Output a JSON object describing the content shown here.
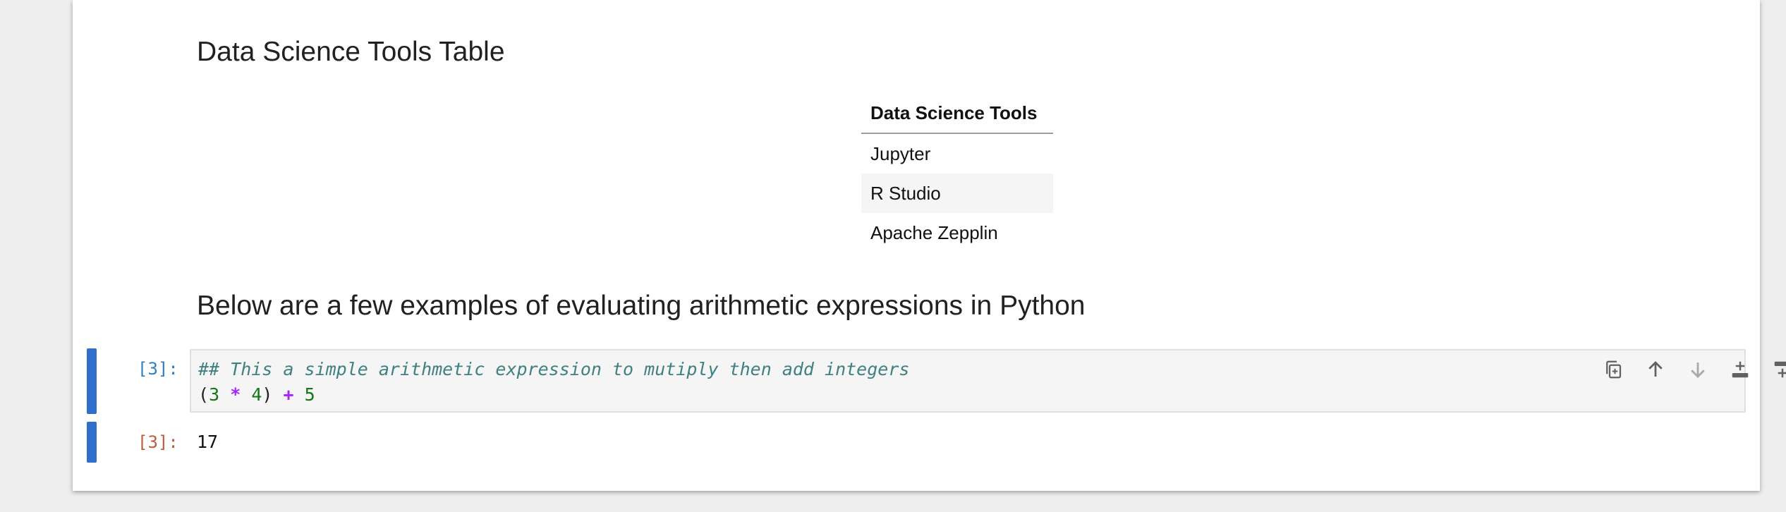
{
  "markdown": {
    "heading_1": "Data Science Tools Table",
    "heading_2": "Below are a few examples of evaluating arithmetic expressions in Python"
  },
  "tools_table": {
    "header": "Data Science Tools",
    "rows": [
      "Jupyter",
      "R Studio",
      "Apache Zepplin"
    ]
  },
  "code_cell": {
    "in_prompt": "[3]:",
    "comment": "##  This a simple arithmetic expression to mutiply then add integers",
    "tokens": {
      "open_paren": "(",
      "n1": "3",
      "op1": "*",
      "n2": "4",
      "close_paren": ")",
      "op2": "+",
      "n3": "5"
    }
  },
  "output_cell": {
    "out_prompt": "[3]:",
    "value": "17"
  },
  "toolbar": {
    "icons": [
      "duplicate-icon",
      "move-up-icon",
      "move-down-icon",
      "insert-above-icon",
      "insert-below-icon",
      "delete-icon"
    ]
  },
  "colors": {
    "cell_bar": "#2f6fcb",
    "in_prompt": "#307fc1",
    "out_prompt": "#bf5b3d",
    "comment": "#408080",
    "number": "#117711",
    "operator": "#aa22ff"
  }
}
